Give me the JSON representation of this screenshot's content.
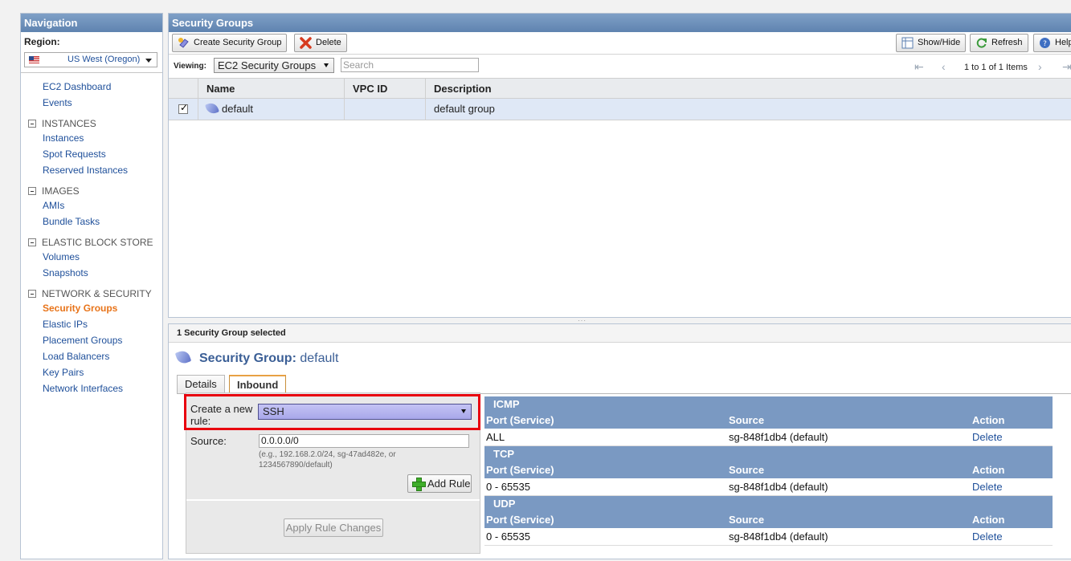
{
  "nav": {
    "title": "Navigation",
    "region_label": "Region:",
    "region_value": "US West (Oregon)",
    "links_top": [
      "EC2 Dashboard",
      "Events"
    ],
    "sections": [
      {
        "heading": "INSTANCES",
        "items": [
          "Instances",
          "Spot Requests",
          "Reserved Instances"
        ]
      },
      {
        "heading": "IMAGES",
        "items": [
          "AMIs",
          "Bundle Tasks"
        ]
      },
      {
        "heading": "ELASTIC BLOCK STORE",
        "items": [
          "Volumes",
          "Snapshots"
        ]
      },
      {
        "heading": "NETWORK & SECURITY",
        "items": [
          "Security Groups",
          "Elastic IPs",
          "Placement Groups",
          "Load Balancers",
          "Key Pairs",
          "Network Interfaces"
        ]
      }
    ],
    "active_item": "Security Groups"
  },
  "main": {
    "title": "Security Groups",
    "toolbar": {
      "create": "Create Security Group",
      "delete": "Delete",
      "show_hide": "Show/Hide",
      "refresh": "Refresh",
      "help": "Help"
    },
    "viewing_label": "Viewing:",
    "viewing_value": "EC2 Security Groups",
    "search_placeholder": "Search",
    "pager_text": "1 to 1 of 1 Items",
    "columns": [
      "Name",
      "VPC ID",
      "Description"
    ],
    "rows": [
      {
        "checked": true,
        "name": "default",
        "vpc_id": "",
        "description": "default group"
      }
    ]
  },
  "details": {
    "selected_text": "1 Security Group selected",
    "heading_label": "Security Group:",
    "heading_value": "default",
    "tabs": [
      "Details",
      "Inbound"
    ],
    "active_tab": "Inbound",
    "create_rule_label": "Create a new rule:",
    "create_rule_value": "SSH",
    "source_label": "Source:",
    "source_value": "0.0.0.0/0",
    "source_hint": "(e.g., 192.168.2.0/24, sg-47ad482e, or 1234567890/default)",
    "add_rule": "Add Rule",
    "apply_changes": "Apply Rule Changes",
    "rule_columns": [
      "Port (Service)",
      "Source",
      "Action"
    ],
    "protocols": [
      {
        "name": "ICMP",
        "rows": [
          {
            "port": "ALL",
            "source": "sg-848f1db4 (default)",
            "action": "Delete"
          }
        ]
      },
      {
        "name": "TCP",
        "rows": [
          {
            "port": "0 - 65535",
            "source": "sg-848f1db4 (default)",
            "action": "Delete"
          }
        ]
      },
      {
        "name": "UDP",
        "rows": [
          {
            "port": "0 - 65535",
            "source": "sg-848f1db4 (default)",
            "action": "Delete"
          }
        ]
      }
    ]
  },
  "colors": {
    "panel_header": "#6b8dba",
    "active_link": "#e8741a",
    "link": "#1e4f9a",
    "highlight_border": "#e8000e",
    "selected_row": "#dfe8f6"
  }
}
